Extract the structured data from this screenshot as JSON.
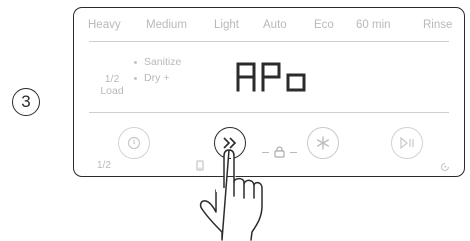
{
  "step": {
    "number": "3"
  },
  "panel": {
    "programs": [
      "Heavy",
      "Medium",
      "Light",
      "Auto",
      "Eco",
      "60 min",
      "Rinse"
    ],
    "load_line1": "1/2",
    "load_line2": "Load",
    "options": [
      "Sanitize",
      "Dry +"
    ],
    "display_text": "APo",
    "bottom_left_label": "1/2",
    "buttons": [
      "power-button",
      "fast-forward-button",
      "star-button",
      "play-pause-button"
    ],
    "active_button": "fast-forward-button"
  },
  "colors": {
    "line": "#2b2b2b",
    "inactive": "#b9b9b9",
    "background": "#ffffff"
  }
}
